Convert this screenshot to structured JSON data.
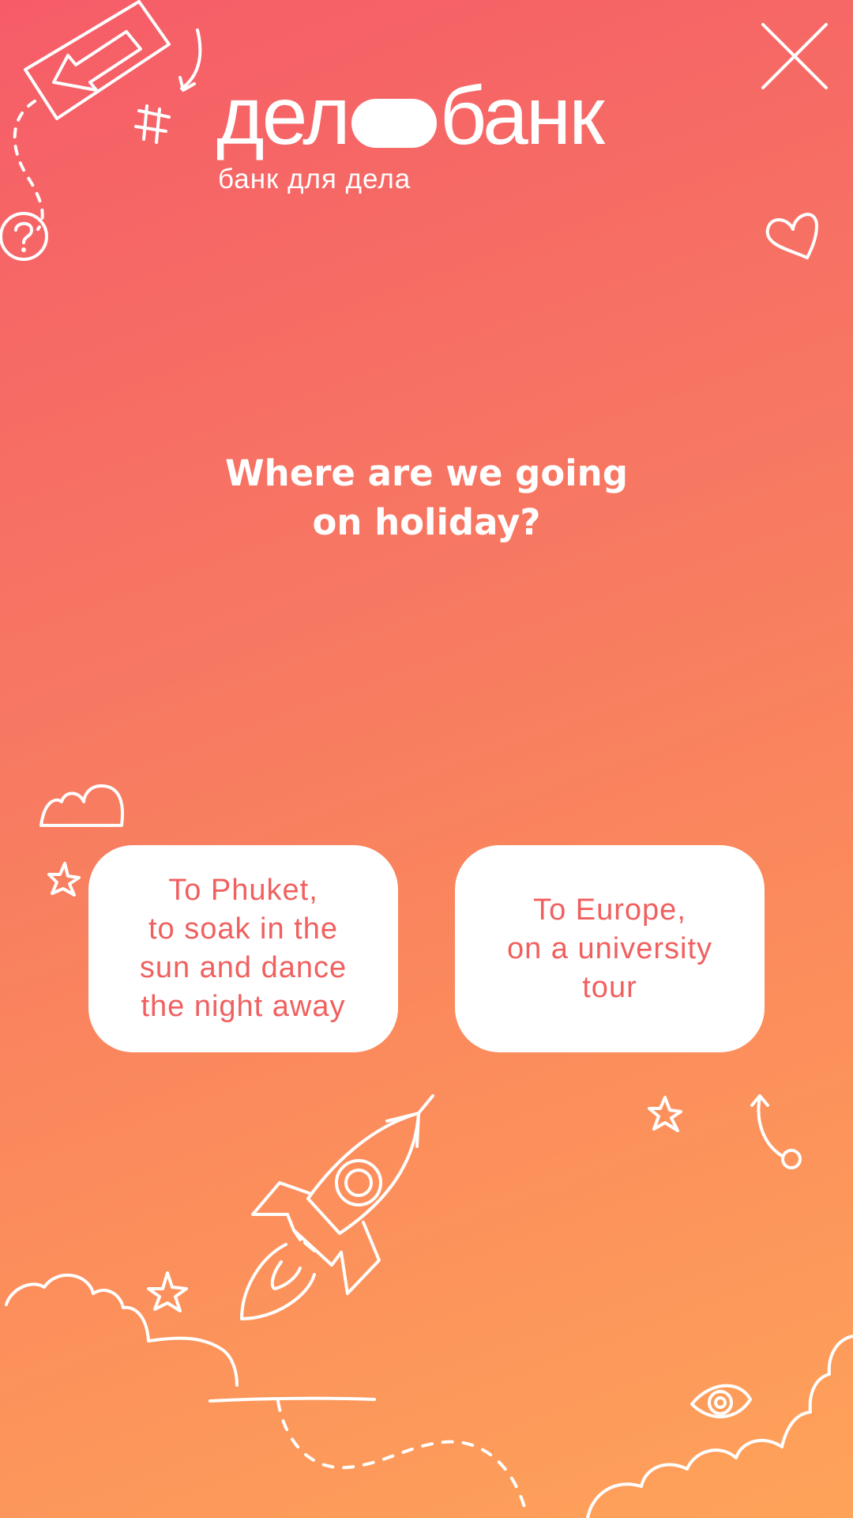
{
  "brand": {
    "name_left": "дел",
    "name_right": "банк",
    "tagline": "банк для дела"
  },
  "quiz": {
    "question_line1": "Where are we going",
    "question_line2": "on holiday?",
    "answers": [
      {
        "label": "To Phuket,\nto soak in the\nsun and dance\nthe night away"
      },
      {
        "label": "To Europe,\non a university\ntour"
      }
    ]
  },
  "colors": {
    "gradient_top": "#f65c68",
    "gradient_bottom": "#fea35a",
    "answer_text": "#f0605f"
  },
  "icons": [
    "close-icon",
    "question-mark-icon",
    "arrow-sign-icon",
    "hashtag-icon",
    "heart-icon",
    "cloud-icon",
    "star-icon",
    "rocket-icon",
    "eye-icon",
    "curved-arrow-icon"
  ]
}
